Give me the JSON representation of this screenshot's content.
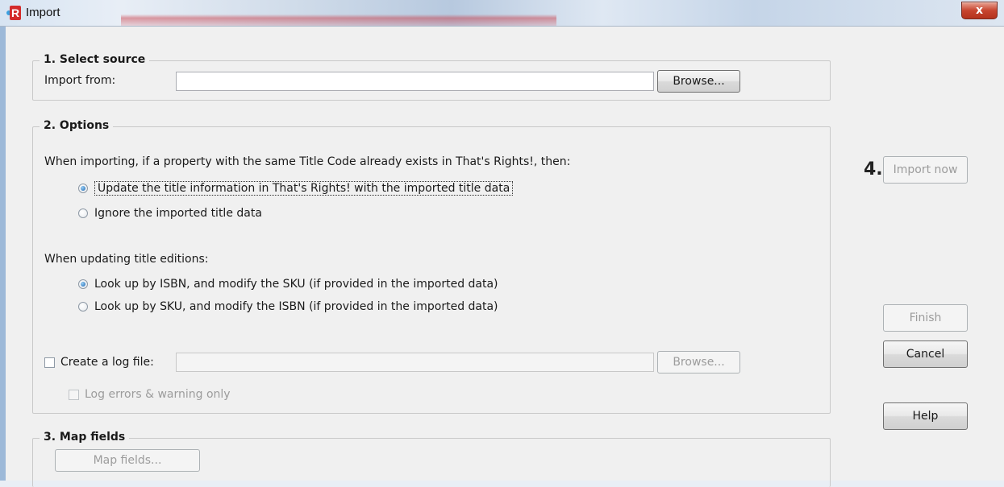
{
  "window": {
    "title": "Import",
    "close_glyph": "x",
    "app_icon_letter": "R"
  },
  "section1": {
    "title": "1. Select source",
    "import_from_label": "Import from:",
    "import_from_value": "",
    "browse_label": "Browse..."
  },
  "section2": {
    "title": "2. Options",
    "question": "When importing, if a property with the same Title Code already exists in That's Rights!, then:",
    "radios1": [
      {
        "label": "Update the title information in That's Rights! with the imported title data",
        "checked": true
      },
      {
        "label": "Ignore the imported title data",
        "checked": false
      }
    ],
    "editions_label": "When updating title editions:",
    "radios2": [
      {
        "label": "Look up by ISBN, and modify the SKU (if provided in the imported data)",
        "checked": true
      },
      {
        "label": "Look up by SKU, and modify the ISBN (if provided in the imported data)",
        "checked": false
      }
    ],
    "log_file_label": "Create a log file:",
    "log_file_value": "",
    "log_browse_label": "Browse...",
    "log_errors_label": "Log errors & warning only"
  },
  "section3": {
    "title": "3. Map fields",
    "map_fields_label": "Map fields..."
  },
  "side": {
    "step4": "4.",
    "import_now_label": "Import now",
    "finish_label": "Finish",
    "cancel_label": "Cancel",
    "help_label": "Help"
  }
}
